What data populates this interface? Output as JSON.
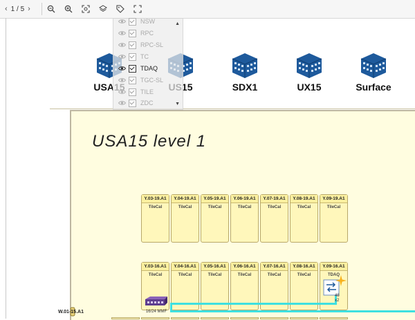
{
  "toolbar": {
    "page_text": "1 / 5",
    "prev_icon": "chevron-left-icon",
    "next_icon": "chevron-right-icon",
    "buttons": [
      "zoom-out-icon",
      "zoom-in-icon",
      "fit-view-icon",
      "layers-icon",
      "tag-icon",
      "fullscreen-icon"
    ]
  },
  "buildings": [
    {
      "name": "USA15"
    },
    {
      "name": "US15"
    },
    {
      "name": "SDX1"
    },
    {
      "name": "UX15"
    },
    {
      "name": "Surface"
    }
  ],
  "layers_popup": {
    "items": [
      {
        "label": "NSW",
        "active": false
      },
      {
        "label": "RPC",
        "active": false
      },
      {
        "label": "RPC-SL",
        "active": false
      },
      {
        "label": "TC",
        "active": false
      },
      {
        "label": "TDAQ",
        "active": true
      },
      {
        "label": "TGC-SL",
        "active": false
      },
      {
        "label": "TILE",
        "active": false
      },
      {
        "label": "ZDC",
        "active": false
      }
    ]
  },
  "plan": {
    "title": "USA15 level 1",
    "row1": [
      {
        "id": "Y.03-19.A1",
        "sub": "TileCal"
      },
      {
        "id": "Y.04-19.A1",
        "sub": "TileCal"
      },
      {
        "id": "Y.05-19.A1",
        "sub": "TileCal"
      },
      {
        "id": "Y.06-19.A1",
        "sub": "TileCal"
      },
      {
        "id": "Y.07-19.A1",
        "sub": "TileCal"
      },
      {
        "id": "Y.08-19.A1",
        "sub": "TileCal"
      },
      {
        "id": "Y.09-19.A1",
        "sub": "TileCal"
      }
    ],
    "row2": [
      {
        "id": "Y.03-16.A1",
        "sub": "TileCal"
      },
      {
        "id": "Y.04-16.A1",
        "sub": "TileCal"
      },
      {
        "id": "Y.05-16.A1",
        "sub": "TileCal"
      },
      {
        "id": "Y.06-16.A1",
        "sub": "TileCal"
      },
      {
        "id": "Y.07-16.A1",
        "sub": "TileCal"
      },
      {
        "id": "Y.08-16.A1",
        "sub": "TileCal"
      },
      {
        "id": "Y.09-16.A1",
        "sub": "TDAQ"
      }
    ],
    "patch_panel_label": "16/24 MMF",
    "switch_port_label": "48",
    "switch_count_label": "x2",
    "wall_label": "W.01-15.A1"
  },
  "colors": {
    "building": "#1e5a9c",
    "cable": "#3ee0e0",
    "rack_fill": "#fff7bb",
    "plan_bg": "#fffde0"
  }
}
